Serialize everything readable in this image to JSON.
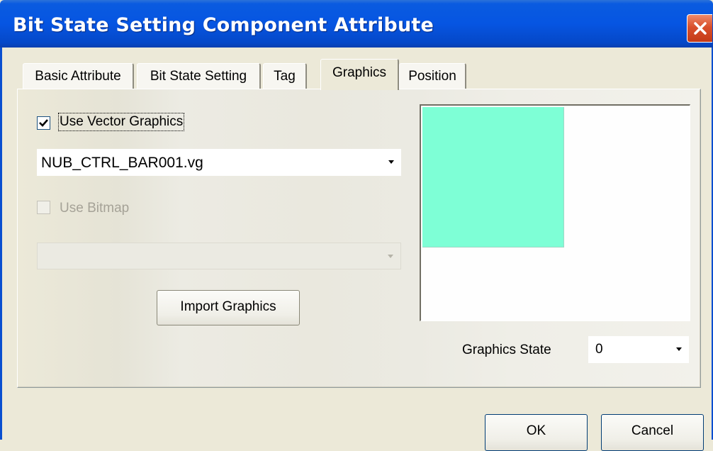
{
  "window": {
    "title": "Bit State Setting Component Attribute"
  },
  "tabs": [
    {
      "label": "Basic Attribute",
      "active": false
    },
    {
      "label": "Bit State Setting",
      "active": false
    },
    {
      "label": "Tag",
      "active": false
    },
    {
      "label": "Graphics",
      "active": true
    },
    {
      "label": "Position",
      "active": false
    }
  ],
  "graphics": {
    "use_vector_label": "Use Vector Graphics",
    "use_vector_checked": true,
    "vector_file": "NUB_CTRL_BAR001.vg",
    "use_bitmap_label": "Use Bitmap",
    "use_bitmap_checked": false,
    "bitmap_file": "",
    "import_label": "Import Graphics",
    "preview_fill_color": "#7effd6",
    "state_label": "Graphics State",
    "state_value": "0"
  },
  "footer": {
    "ok_label": "OK",
    "cancel_label": "Cancel"
  },
  "icons": {
    "close": "close-icon",
    "check": "checkmark-icon",
    "dropdown": "chevron-down-icon"
  }
}
